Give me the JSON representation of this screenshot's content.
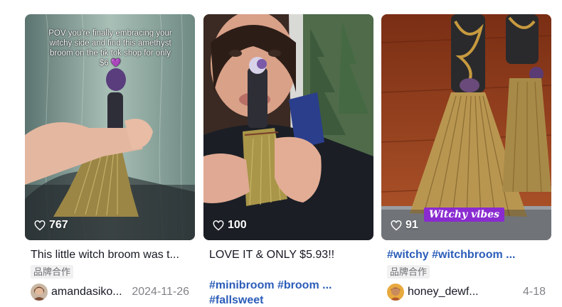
{
  "cards": [
    {
      "likes": "767",
      "overlay_caption": "POV you're finally embracing your witchy side and find this amethyst broom on the tik tok shop for only $6 💜",
      "description": "This little witch broom was t...",
      "brand_label": "品牌合作",
      "username": "amandasiko...",
      "date": "2024-11-26"
    },
    {
      "likes": "100",
      "description": "LOVE IT & ONLY $5.93!!",
      "hashtags_line1": "#minibroom #broom ...",
      "hashtags_line2": "#fallsweet"
    },
    {
      "likes": "91",
      "overlay_badge": "Witchy vibes",
      "description": "#witchy #witchbroom ...",
      "brand_label": "品牌合作",
      "username": "honey_dewf...",
      "date": "4-18"
    }
  ],
  "colors": {
    "hashtag": "#2b5db9",
    "badge": "#8a2bd0",
    "date": "#8a8b91"
  },
  "icons": {
    "likes": "heart-outline-icon"
  }
}
